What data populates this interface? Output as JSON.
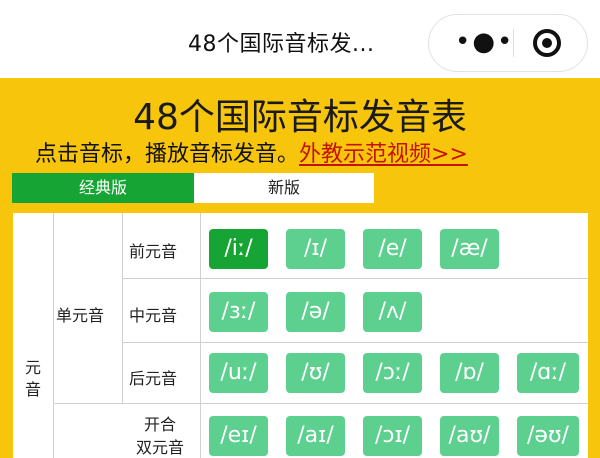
{
  "nav": {
    "title": "48个国际音标发...",
    "more_icon": "more-dots-icon",
    "close_icon": "target-icon"
  },
  "header": {
    "title": "48个国际音标发音表",
    "instruction": "点击音标，播放音标发音。",
    "video_link": "外教示范视频>>"
  },
  "tabs": [
    {
      "label": "经典版",
      "active": true
    },
    {
      "label": "新版",
      "active": false
    }
  ],
  "table": {
    "category_top": "元",
    "category_bottom": "音",
    "subcategory": "单元音",
    "rows": [
      {
        "label": "前元音",
        "symbols": [
          "/iː/",
          "/ɪ/",
          "/e/",
          "/æ/"
        ]
      },
      {
        "label": "中元音",
        "symbols": [
          "/ɜː/",
          "/ə/",
          "/ʌ/"
        ]
      },
      {
        "label": "后元音",
        "symbols": [
          "/uː/",
          "/ʊ/",
          "/ɔː/",
          "/ɒ/",
          "/ɑː/"
        ]
      },
      {
        "label_line1": "开合",
        "label_line2": "双元音",
        "symbols": [
          "/eɪ/",
          "/aɪ/",
          "/ɔɪ/",
          "/aʊ/",
          "/əʊ/"
        ]
      }
    ]
  },
  "colors": {
    "brand_yellow": "#f7c50c",
    "active_green": "#16a534",
    "button_green": "#5dcf8f",
    "link_red": "#c41200"
  }
}
